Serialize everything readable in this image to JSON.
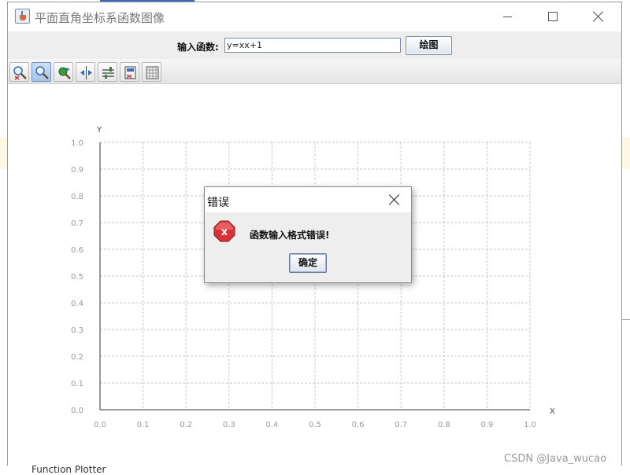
{
  "window": {
    "title": "平面直角坐标系函数图像"
  },
  "input_bar": {
    "label": "输入函数:",
    "value": "y=xx+1",
    "plot_button": "绘图"
  },
  "toolbar": {
    "tools": [
      {
        "icon": "zoom-reset-icon"
      },
      {
        "icon": "zoom-icon",
        "active": true
      },
      {
        "icon": "pan-icon"
      },
      {
        "icon": "fit-icon"
      },
      {
        "icon": "axis-settings-icon"
      },
      {
        "icon": "save-icon"
      },
      {
        "icon": "grid-icon"
      }
    ]
  },
  "chart_data": {
    "type": "line",
    "x_axis_label": "X",
    "y_axis_label": "Y",
    "xlim": [
      0.0,
      1.0
    ],
    "ylim": [
      0.0,
      1.0
    ],
    "x_ticks": [
      "0.0",
      "0.1",
      "0.2",
      "0.3",
      "0.4",
      "0.5",
      "0.6",
      "0.7",
      "0.8",
      "0.9",
      "1.0"
    ],
    "y_ticks": [
      "0.0",
      "0.1",
      "0.2",
      "0.3",
      "0.4",
      "0.5",
      "0.6",
      "0.7",
      "0.8",
      "0.9",
      "1.0"
    ],
    "grid": true,
    "series": []
  },
  "dialog": {
    "title": "错误",
    "message": "函数输入格式错误!",
    "ok_button": "确定",
    "icon": "error-icon"
  },
  "background": {
    "partial_text": "Function Plotter"
  },
  "watermark": "CSDN @Java_wucao",
  "colors": {
    "grid": "#c8c8c8",
    "axis": "#333333",
    "tick_label": "#9a9a9a",
    "error_red": "#d8333a"
  }
}
